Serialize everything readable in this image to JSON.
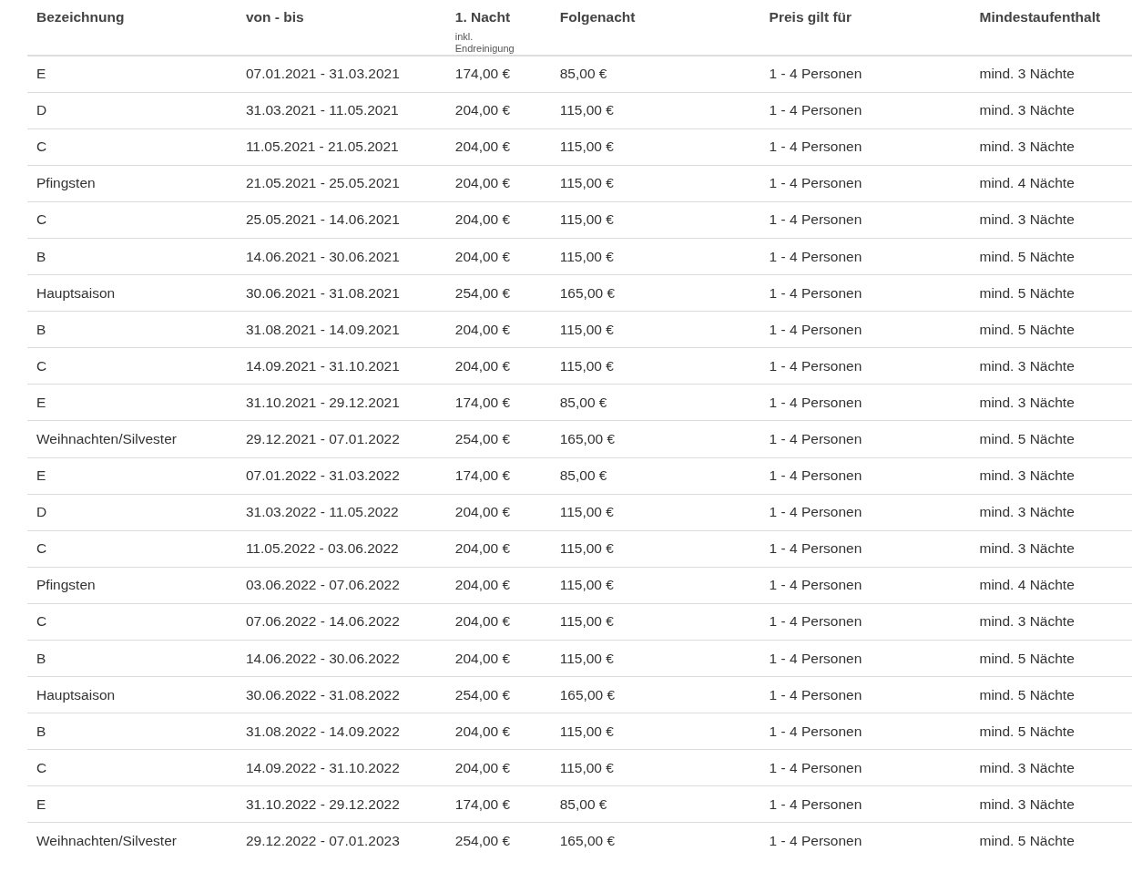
{
  "table": {
    "columns": [
      {
        "label": "Bezeichnung"
      },
      {
        "label": "von - bis"
      },
      {
        "label": "1. Nacht",
        "note": "inkl. Endreinigung"
      },
      {
        "label": "Folgenacht"
      },
      {
        "label": "Preis gilt für"
      },
      {
        "label": "Mindestaufenthalt"
      }
    ],
    "rows": [
      [
        "E",
        "07.01.2021 - 31.03.2021",
        "174,00 €",
        "85,00 €",
        "1 - 4 Personen",
        "mind. 3 Nächte"
      ],
      [
        "D",
        "31.03.2021 - 11.05.2021",
        "204,00 €",
        "115,00 €",
        "1 - 4 Personen",
        "mind. 3 Nächte"
      ],
      [
        "C",
        "11.05.2021 - 21.05.2021",
        "204,00 €",
        "115,00 €",
        "1 - 4 Personen",
        "mind. 3 Nächte"
      ],
      [
        "Pfingsten",
        "21.05.2021 - 25.05.2021",
        "204,00 €",
        "115,00 €",
        "1 - 4 Personen",
        "mind. 4 Nächte"
      ],
      [
        "C",
        "25.05.2021 - 14.06.2021",
        "204,00 €",
        "115,00 €",
        "1 - 4 Personen",
        "mind. 3 Nächte"
      ],
      [
        "B",
        "14.06.2021 - 30.06.2021",
        "204,00 €",
        "115,00 €",
        "1 - 4 Personen",
        "mind. 5 Nächte"
      ],
      [
        "Hauptsaison",
        "30.06.2021 - 31.08.2021",
        "254,00 €",
        "165,00 €",
        "1 - 4 Personen",
        "mind. 5 Nächte"
      ],
      [
        "B",
        "31.08.2021 - 14.09.2021",
        "204,00 €",
        "115,00 €",
        "1 - 4 Personen",
        "mind. 5 Nächte"
      ],
      [
        "C",
        "14.09.2021 - 31.10.2021",
        "204,00 €",
        "115,00 €",
        "1 - 4 Personen",
        "mind. 3 Nächte"
      ],
      [
        "E",
        "31.10.2021 - 29.12.2021",
        "174,00 €",
        "85,00 €",
        "1 - 4 Personen",
        "mind. 3 Nächte"
      ],
      [
        "Weihnachten/Silvester",
        "29.12.2021 - 07.01.2022",
        "254,00 €",
        "165,00 €",
        "1 - 4 Personen",
        "mind. 5 Nächte"
      ],
      [
        "E",
        "07.01.2022 - 31.03.2022",
        "174,00 €",
        "85,00 €",
        "1 - 4 Personen",
        "mind. 3 Nächte"
      ],
      [
        "D",
        "31.03.2022 - 11.05.2022",
        "204,00 €",
        "115,00 €",
        "1 - 4 Personen",
        "mind. 3 Nächte"
      ],
      [
        "C",
        "11.05.2022 - 03.06.2022",
        "204,00 €",
        "115,00 €",
        "1 - 4 Personen",
        "mind. 3 Nächte"
      ],
      [
        "Pfingsten",
        "03.06.2022 - 07.06.2022",
        "204,00 €",
        "115,00 €",
        "1 - 4 Personen",
        "mind. 4 Nächte"
      ],
      [
        "C",
        "07.06.2022 - 14.06.2022",
        "204,00 €",
        "115,00 €",
        "1 - 4 Personen",
        "mind. 3 Nächte"
      ],
      [
        "B",
        "14.06.2022 - 30.06.2022",
        "204,00 €",
        "115,00 €",
        "1 - 4 Personen",
        "mind. 5 Nächte"
      ],
      [
        "Hauptsaison",
        "30.06.2022 - 31.08.2022",
        "254,00 €",
        "165,00 €",
        "1 - 4 Personen",
        "mind. 5 Nächte"
      ],
      [
        "B",
        "31.08.2022 - 14.09.2022",
        "204,00 €",
        "115,00 €",
        "1 - 4 Personen",
        "mind. 5 Nächte"
      ],
      [
        "C",
        "14.09.2022 - 31.10.2022",
        "204,00 €",
        "115,00 €",
        "1 - 4 Personen",
        "mind. 3 Nächte"
      ],
      [
        "E",
        "31.10.2022 - 29.12.2022",
        "174,00 €",
        "85,00 €",
        "1 - 4 Personen",
        "mind. 3 Nächte"
      ],
      [
        "Weihnachten/Silvester",
        "29.12.2022 - 07.01.2023",
        "254,00 €",
        "165,00 €",
        "1 - 4 Personen",
        "mind. 5 Nächte"
      ]
    ]
  }
}
